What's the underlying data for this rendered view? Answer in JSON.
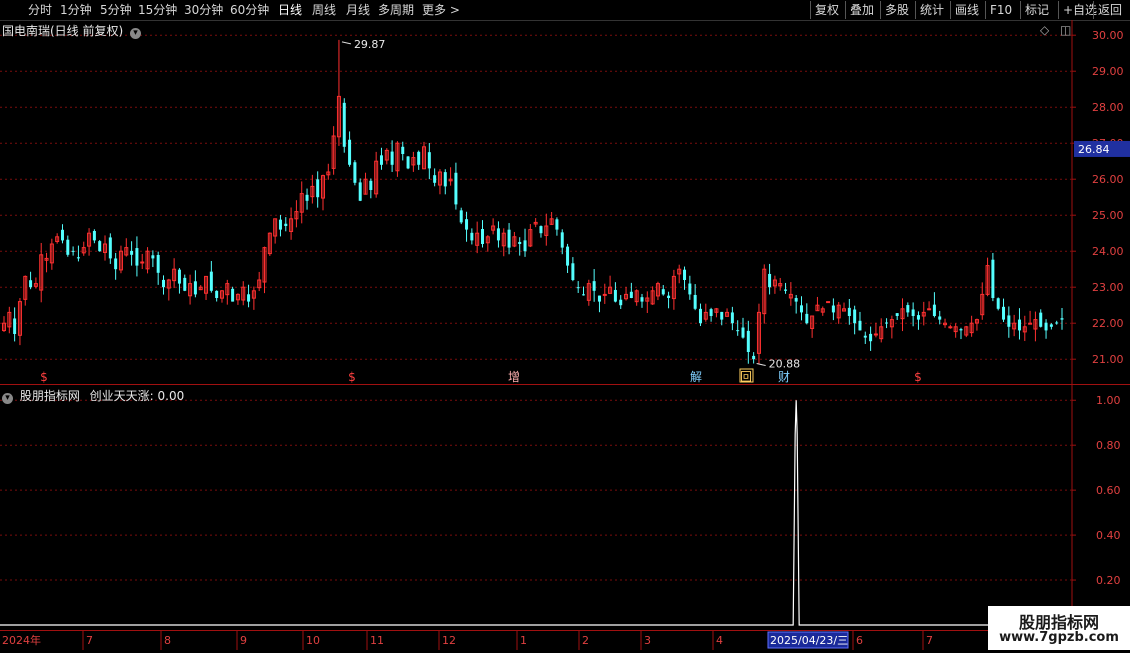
{
  "toolbar": {
    "periods": [
      "分时",
      "1分钟",
      "5分钟",
      "15分钟",
      "30分钟",
      "60分钟",
      "日线",
      "周线",
      "月线",
      "多周期",
      "更多 >"
    ],
    "active_period": "日线",
    "right_buttons": [
      "复权",
      "叠加",
      "多股",
      "统计",
      "画线",
      "F10",
      "标记",
      "+自选",
      "返回"
    ]
  },
  "main": {
    "title": "国电南瑞(日线 前复权)",
    "price_labels": [
      "30.00",
      "29.00",
      "28.00",
      "27.00",
      "26.00",
      "25.00",
      "24.00",
      "23.00",
      "22.00",
      "21.00"
    ],
    "current_price": "26.84",
    "high_label": "29.87",
    "low_label": "20.88",
    "markers": [
      "$",
      "$",
      "增",
      "解",
      "回",
      "财",
      "$"
    ]
  },
  "sub": {
    "title": "股朋指标网",
    "indicator": "创业天天涨: 0.00",
    "scale_labels": [
      "1.00",
      "0.80",
      "0.60",
      "0.40",
      "0.20"
    ]
  },
  "time_axis": {
    "labels": [
      "2024年",
      "7",
      "8",
      "9",
      "10",
      "11",
      "12",
      "1",
      "2",
      "3",
      "4",
      "5",
      "6",
      "7"
    ],
    "highlight": "2025/04/23/三"
  },
  "logo": {
    "line1": "股朋指标网",
    "line2": "www.7gpzb.com"
  },
  "colors": {
    "up": "#ff3030",
    "down": "#54ffff",
    "grid": "#7a0d0d",
    "axis": "#a01010",
    "price_tag_bg": "#2030a0"
  },
  "chart_data": [
    {
      "type": "candlestick",
      "title": "国电南瑞(日线 前复权)",
      "ylim": [
        20.7,
        30.2
      ],
      "yticks": [
        21,
        22,
        23,
        24,
        25,
        26,
        27,
        28,
        29,
        30
      ],
      "x_month_labels": [
        "2024年",
        "7",
        "8",
        "9",
        "10",
        "11",
        "12",
        "1",
        "2",
        "3",
        "4",
        "5",
        "6",
        "7"
      ],
      "close_path": [
        22.0,
        22.3,
        21.7,
        22.6,
        23.3,
        23.0,
        23.1,
        23.9,
        23.8,
        24.2,
        24.4,
        24.3,
        23.9,
        24.0,
        23.8,
        24.1,
        24.5,
        24.3,
        24.0,
        24.2,
        23.8,
        23.5,
        24.0,
        24.1,
        23.9,
        23.6,
        23.7,
        24.0,
        23.8,
        23.4,
        23.0,
        23.2,
        23.5,
        23.1,
        22.9,
        23.1,
        22.8,
        23.0,
        23.3,
        22.9,
        22.7,
        22.9,
        23.1,
        22.6,
        22.8,
        23.0,
        22.6,
        22.9,
        23.2,
        24.1,
        24.5,
        24.9,
        24.6,
        24.7,
        24.9,
        25.1,
        25.6,
        25.4,
        25.8,
        25.5,
        26.1,
        26.2,
        27.2,
        28.3,
        26.9,
        26.4,
        25.9,
        25.4,
        26.0,
        25.7,
        26.5,
        26.4,
        26.8,
        26.4,
        27.0,
        26.7,
        26.3,
        26.6,
        26.4,
        26.9,
        26.3,
        25.9,
        26.2,
        25.8,
        26.0,
        25.3,
        24.8,
        24.6,
        24.3,
        24.5,
        24.2,
        24.4,
        24.7,
        24.3,
        24.5,
        24.1,
        24.4,
        24.2,
        24.0,
        24.6,
        24.8,
        24.5,
        24.7,
        24.9,
        24.6,
        24.1,
        23.6,
        23.2,
        23.0,
        22.8,
        23.1,
        22.9,
        22.6,
        22.8,
        23.0,
        22.6,
        22.5,
        22.8,
        22.7,
        22.9,
        22.6,
        22.7,
        22.9,
        23.1,
        22.8,
        22.7,
        23.3,
        23.5,
        23.2,
        22.8,
        22.4,
        22.0,
        22.3,
        22.2,
        22.4,
        22.1,
        22.3,
        22.0,
        21.8,
        21.6,
        21.2,
        21.0,
        22.3,
        23.5,
        23.0,
        23.2,
        23.1,
        22.9,
        22.8,
        22.6,
        22.3,
        22.0,
        22.2,
        22.5,
        22.4,
        22.6,
        22.3,
        22.5,
        22.4,
        22.2,
        22.0,
        21.8,
        21.6,
        21.5,
        21.7,
        21.9,
        22.0,
        22.1,
        22.2,
        22.4,
        22.3,
        22.2,
        22.1,
        22.3,
        22.4,
        22.2,
        22.1,
        22.0,
        21.9,
        21.9,
        21.8,
        21.9,
        22.0,
        22.1,
        22.8,
        23.6,
        22.7,
        22.4,
        22.1,
        21.9,
        22.0,
        21.8,
        21.9,
        22.0,
        22.1,
        21.9,
        21.8,
        21.9,
        22.0,
        22.1
      ],
      "high": 29.87,
      "low": 20.88,
      "current": 26.84
    },
    {
      "type": "line",
      "title": "创业天天涨",
      "value": 0.0,
      "ylim": [
        0,
        1.05
      ],
      "yticks": [
        0.2,
        0.4,
        0.6,
        0.8,
        1.0
      ],
      "spike": {
        "index": 149,
        "value": 1.0
      }
    }
  ]
}
